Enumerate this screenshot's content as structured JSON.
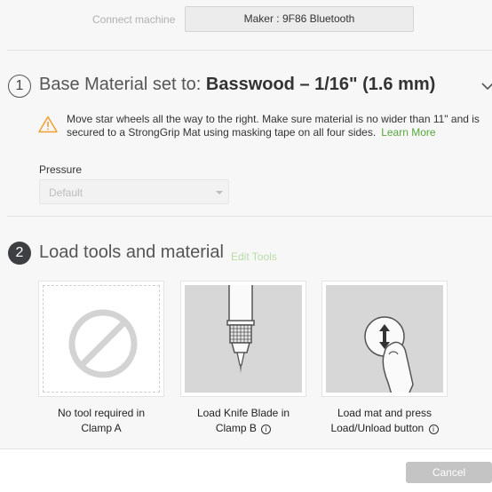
{
  "header": {
    "connect_label": "Connect machine",
    "machine_name": "Maker : 9F86 Bluetooth"
  },
  "step1": {
    "number": "1",
    "title_prefix": "Base Material set to: ",
    "material": "Basswood – 1/16\" (1.6 mm)",
    "warning_text": "Move star wheels all the way to the right. Make sure material is no wider than 11\" and is secured to a StrongGrip Mat using masking tape on all four sides.",
    "learn_more": "Learn More",
    "pressure_label": "Pressure",
    "pressure_value": "Default"
  },
  "step2": {
    "number": "2",
    "title": "Load tools and material",
    "edit_tools": "Edit Tools",
    "cards": [
      {
        "caption_line1": "No tool required in",
        "caption_line2": "Clamp A"
      },
      {
        "caption_line1": "Load Knife Blade in",
        "caption_line2": "Clamp B"
      },
      {
        "caption_line1": "Load mat and press",
        "caption_line2": "Load/Unload button"
      }
    ],
    "info_glyph": "i"
  },
  "footer": {
    "cancel_label": "Cancel"
  },
  "colors": {
    "accent_green": "#57a83e",
    "edit_tools_green": "#b9dca6",
    "warning_orange": "#f0a030",
    "step_active_bg": "#3d3f42"
  }
}
